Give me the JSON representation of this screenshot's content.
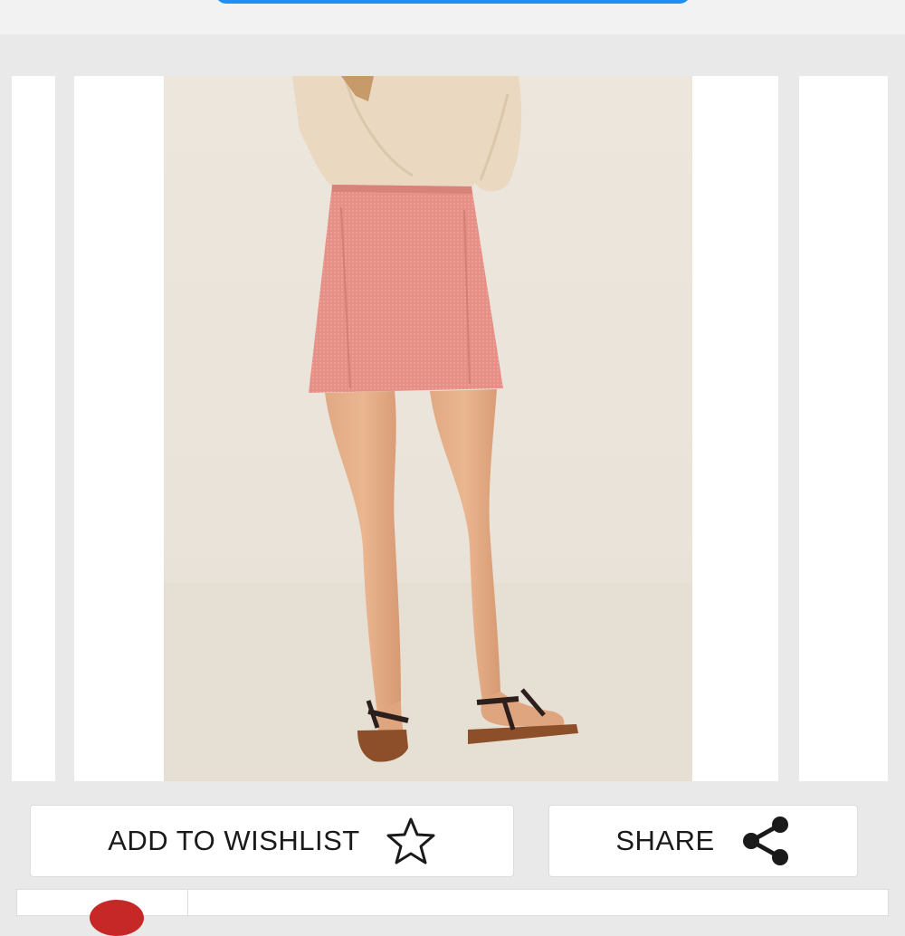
{
  "gallery": {
    "image_alt": "Pink textured mini skirt, back view",
    "current_index": 1
  },
  "actions": {
    "wishlist_label": "ADD TO WISHLIST",
    "wishlist_icon": "star-outline-icon",
    "share_label": "SHARE",
    "share_icon": "share-icon"
  },
  "colors": {
    "accent": "#1e8ff5",
    "background": "#e9e9e9",
    "card": "#ffffff",
    "text": "#1a1a1a",
    "badge": "#c62828"
  }
}
